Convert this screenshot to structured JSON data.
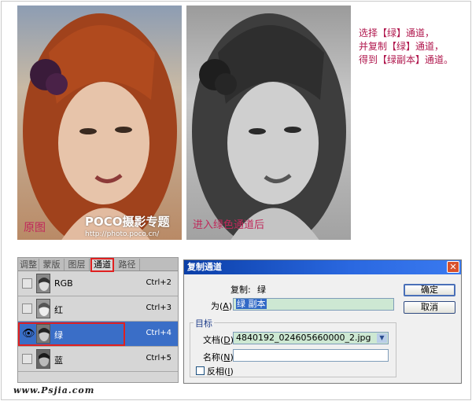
{
  "photos": {
    "original_caption": "原图",
    "watermark_brand": "POCO摄影专题",
    "watermark_url": "http://photo.poco.cn/",
    "gray_caption": "进入绿色通道后"
  },
  "instruction": {
    "lines": [
      "选择【绿】通道，",
      "并复制【绿】通道，",
      "得到【绿副本】通道。"
    ]
  },
  "channels_panel": {
    "tabs": [
      "调整",
      "蒙版",
      "图层",
      "通道",
      "路径"
    ],
    "active_tab": "通道",
    "rows": [
      {
        "name": "RGB",
        "shortcut": "Ctrl+2",
        "visible": false,
        "selected": false
      },
      {
        "name": "红",
        "shortcut": "Ctrl+3",
        "visible": false,
        "selected": false
      },
      {
        "name": "绿",
        "shortcut": "Ctrl+4",
        "visible": true,
        "selected": true
      },
      {
        "name": "蓝",
        "shortcut": "Ctrl+5",
        "visible": false,
        "selected": false
      }
    ],
    "eye_icon": "eye-icon"
  },
  "dialog": {
    "title": "复制通道",
    "close_glyph": "✕",
    "copy_label": "复制:",
    "copy_value": "绿",
    "as_label_pre": "为(",
    "as_label_key": "A",
    "as_label_post": "):",
    "as_value": "绿 副本",
    "ok_label": "确定",
    "cancel_label": "取消",
    "target_group_label": "目标",
    "document_label_pre": "文档(",
    "document_label_key": "D",
    "document_label_post": "):",
    "document_value": "4840192_024605660000_2.jpg",
    "name_label_pre": "名称(",
    "name_label_key": "N",
    "name_label_post": "):",
    "name_value": "",
    "invert_label_pre": "反相(",
    "invert_label_key": "I",
    "invert_label_post": ")",
    "invert_checked": false
  },
  "footer": {
    "site": "www.Psjia.com"
  },
  "colors": {
    "caption_pink": "#c0285a",
    "selection_blue": "#3a6ec7",
    "highlight_red": "#e02020",
    "title_bar_blue": "#0b3fa8"
  }
}
